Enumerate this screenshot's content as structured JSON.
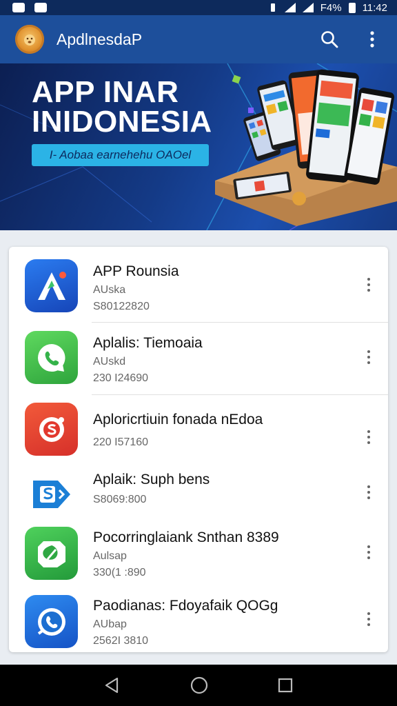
{
  "status_bar": {
    "battery": "F4%",
    "time": "11:42"
  },
  "app_bar": {
    "title": "ApdlnesdaP",
    "search_icon": "search-icon",
    "more_icon": "more-vert-icon"
  },
  "banner": {
    "title_line1": "APP INAR",
    "title_line2": "INIDONESIA",
    "pill_text": "I- Aobaa earnehehu OAOel"
  },
  "apps": [
    {
      "name": "APP Rounsia",
      "subtitle": "AUska",
      "number": "S80122820",
      "icon": "a-letter-icon",
      "color": "#1f63d6"
    },
    {
      "name": "Aplalis: Tiemoaia",
      "subtitle": "AUskd",
      "number": "230 I24690",
      "icon": "phone-chat-icon",
      "color": "#3fbf4a"
    },
    {
      "name": "Aploricrtiuin fonada nEdoa",
      "subtitle": "",
      "number": "220 I57160",
      "icon": "s-badge-icon",
      "color": "#e8462f"
    },
    {
      "name": "Aplaik: Suph bens",
      "subtitle": "",
      "number": "S8069:800",
      "icon": "play-s-icon",
      "color": "#1b7fd6"
    },
    {
      "name": "Pocorringlaiank Snthan 8389",
      "subtitle": "Aulsap",
      "number": "330(1 :890",
      "icon": "leaf-chat-icon",
      "color": "#2fb04a"
    },
    {
      "name": "Paodianas: Fdoyafaik QOGg",
      "subtitle": "AUbap",
      "number": "2562I 3810",
      "icon": "phone-bubble-icon",
      "color": "#1c6fd1"
    }
  ],
  "nav": {
    "back": "back-icon",
    "home": "home-icon",
    "recents": "recents-icon"
  }
}
